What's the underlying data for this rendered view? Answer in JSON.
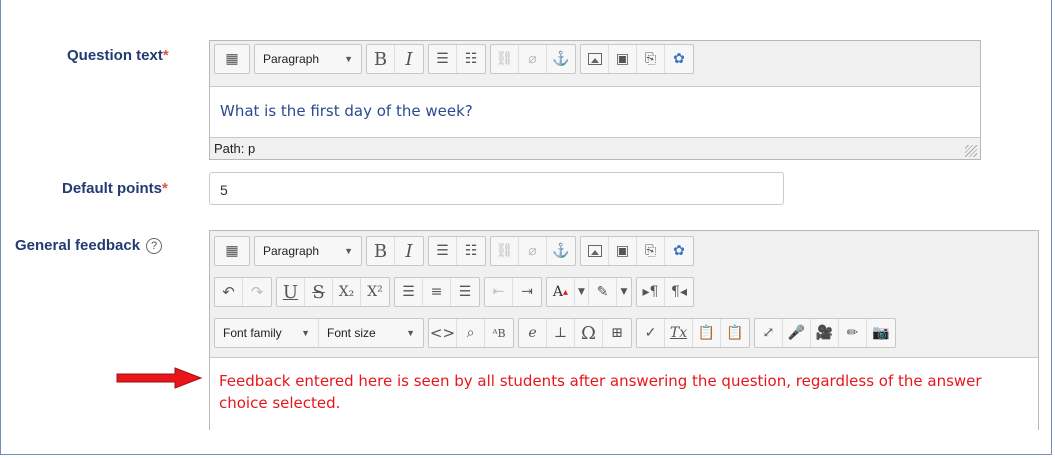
{
  "question_text": {
    "label": "Question text",
    "required_mark": "*",
    "paragraph_select": "Paragraph",
    "bold": "B",
    "italic": "I",
    "content": "What is the first day of the week?",
    "path": "Path: p"
  },
  "default_points": {
    "label": "Default points",
    "required_mark": "*",
    "value": "5"
  },
  "general_feedback": {
    "label": "General feedback",
    "help": "?",
    "paragraph_select": "Paragraph",
    "bold": "B",
    "italic": "I",
    "underline": "U",
    "strike": "S",
    "subscript": "X₂",
    "superscript": "X²",
    "font_family": "Font family",
    "font_size": "Font size",
    "code": "<>",
    "find_replace": "ᴬB",
    "equation": "e",
    "omega": "Ω",
    "clear_format": "Tx",
    "ltr": "▸¶",
    "rtl": "¶◂",
    "content": "Feedback entered here is seen by all students after answering the question, regardless of the answer choice selected.",
    "accent_color": "#e8161b"
  }
}
